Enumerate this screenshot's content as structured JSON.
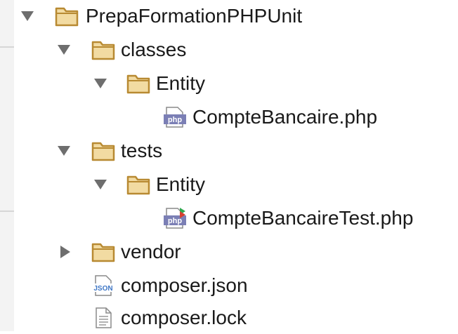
{
  "project_tree": {
    "root": {
      "label": "PrepaFormationPHPUnit",
      "icon": "folder-icon",
      "expanded": true
    },
    "items": [
      {
        "label": "classes",
        "icon": "folder-icon",
        "expanded": true
      },
      {
        "label": "Entity",
        "icon": "folder-icon",
        "expanded": true
      },
      {
        "label": "CompteBancaire.php",
        "icon": "php-file-icon"
      },
      {
        "label": "tests",
        "icon": "folder-icon",
        "expanded": true
      },
      {
        "label": "Entity",
        "icon": "folder-icon",
        "expanded": true
      },
      {
        "label": "CompteBancaireTest.php",
        "icon": "php-test-file-icon"
      },
      {
        "label": "vendor",
        "icon": "folder-icon",
        "expanded": false
      },
      {
        "label": "composer.json",
        "icon": "json-file-icon"
      },
      {
        "label": "composer.lock",
        "icon": "text-file-icon"
      }
    ]
  },
  "icon_badges": {
    "php": "php",
    "json": "JSON"
  },
  "colors": {
    "folder_stroke": "#b88a32",
    "folder_fill": "#f2dba2",
    "php_badge": "#7b7fb5",
    "text": "#1a1a1a",
    "toggle": "#6e6e6e",
    "gutter": "#f3f3f3"
  }
}
